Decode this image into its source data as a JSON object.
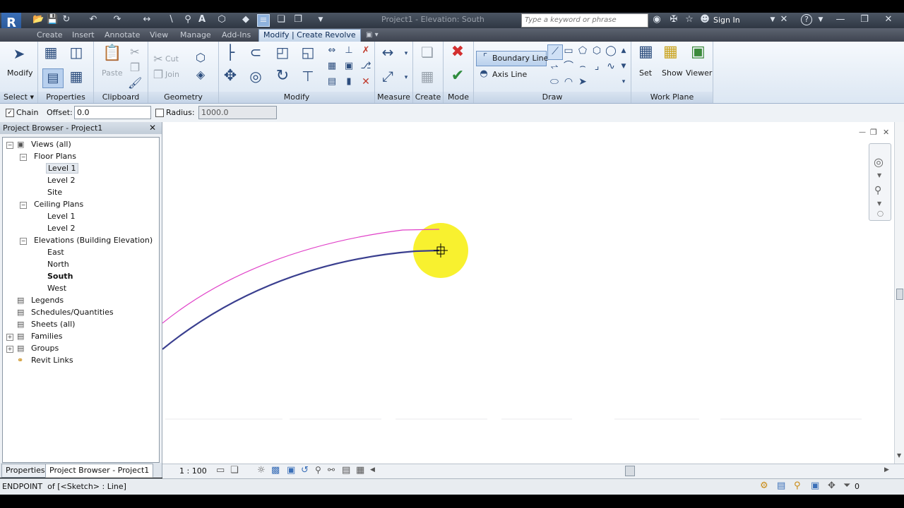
{
  "title_bar": {
    "doc_title": "Project1 - Elevation: South",
    "search_placeholder": "Type a keyword or phrase",
    "sign_in": "Sign In"
  },
  "ribbon_tabs": [
    "Create",
    "Insert",
    "Annotate",
    "View",
    "Manage",
    "Add-Ins"
  ],
  "active_tab": "Modify | Create Revolve",
  "ribbon": {
    "modify_label": "Modify",
    "select_label": "Select",
    "properties_label": "Properties",
    "clipboard_label": "Clipboard",
    "paste_label": "Paste",
    "cut_label": "Cut",
    "join_label": "Join",
    "geometry_label": "Geometry",
    "modify_panel_label": "Modify",
    "measure_label": "Measure",
    "create_label": "Create",
    "mode_label": "Mode",
    "boundary_line": "Boundary Line",
    "axis_line": "Axis Line",
    "draw_label": "Draw",
    "set_label": "Set",
    "show_label": "Show",
    "viewer_label": "Viewer",
    "work_plane_label": "Work Plane"
  },
  "options_bar": {
    "chain_label": "Chain",
    "offset_label": "Offset:",
    "offset_value": "0.0",
    "radius_label": "Radius:",
    "radius_value": "1000.0"
  },
  "project_browser": {
    "title": "Project Browser - Project1",
    "tree": {
      "views_all": "Views (all)",
      "floor_plans": "Floor Plans",
      "fp_level1": "Level 1",
      "fp_level2": "Level 2",
      "fp_site": "Site",
      "ceiling_plans": "Ceiling Plans",
      "cp_level1": "Level 1",
      "cp_level2": "Level 2",
      "elevations": "Elevations (Building Elevation)",
      "el_east": "East",
      "el_north": "North",
      "el_south": "South",
      "el_west": "West",
      "legends": "Legends",
      "schedules": "Schedules/Quantities",
      "sheets": "Sheets (all)",
      "families": "Families",
      "groups": "Groups",
      "revit_links": "Revit Links"
    },
    "tab_properties": "Properties",
    "tab_browser": "Project Browser - Project1"
  },
  "view_control": {
    "scale": "1 : 100"
  },
  "status_bar": {
    "text": "ENDPOINT  of [<Sketch> : Line]",
    "filter_count": "0"
  },
  "colors": {
    "sketch_line": "#e040c8",
    "boundary_line": "#3a3f8f",
    "cursor_highlight": "#f7f01d",
    "ribbon_active_tab": "#c5d6ea"
  }
}
